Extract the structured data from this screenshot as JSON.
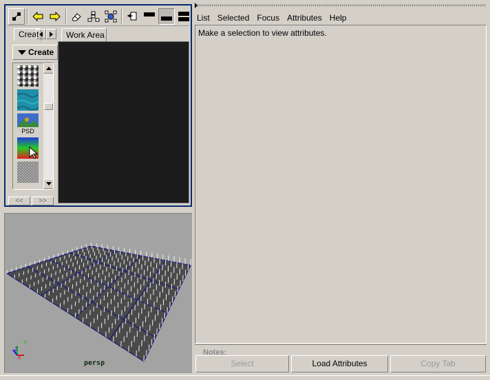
{
  "hypershade": {
    "toolbar": {
      "icons": [
        "graph-layout-icon",
        "back-arrow-icon",
        "forward-arrow-icon",
        "eraser-icon",
        "input-output-connections-icon",
        "graph-network-icon",
        "rearrange-graph-icon",
        "top-tabs-only-icon",
        "bottom-tabs-only-icon",
        "top-and-bottom-tabs-icon"
      ]
    },
    "tabs": {
      "create_label": "Creat",
      "work_area_label": "Work Area"
    },
    "create_bar": {
      "label": "Create"
    },
    "swatches": [
      {
        "name": "noise-texture",
        "label": ""
      },
      {
        "name": "water-texture",
        "label": ""
      },
      {
        "name": "psd-file-texture",
        "label": "PSD"
      },
      {
        "name": "ramp-texture",
        "label": ""
      },
      {
        "name": "cloth-texture",
        "label": ""
      }
    ],
    "nav": {
      "prev_label": "<<",
      "next_label": ">>"
    }
  },
  "viewport": {
    "camera_label": "persp",
    "axis_labels": {
      "x": "X",
      "y": "Y",
      "z": "Z"
    }
  },
  "attribute_editor": {
    "menu": [
      "List",
      "Selected",
      "Focus",
      "Attributes",
      "Help"
    ],
    "message": "Make a selection to view attributes.",
    "notes_label": "Notes:",
    "buttons": {
      "select": "Select",
      "load_attributes": "Load Attributes",
      "copy_tab": "Copy Tab"
    }
  },
  "colors": {
    "panel_focus_border": "#0a2a6e",
    "work_area_bg": "#1c1c1c",
    "viewport_bg": "#a3a3a3",
    "grid_line": "#1a1a7a",
    "plane_fill": "#4a4a4a"
  }
}
